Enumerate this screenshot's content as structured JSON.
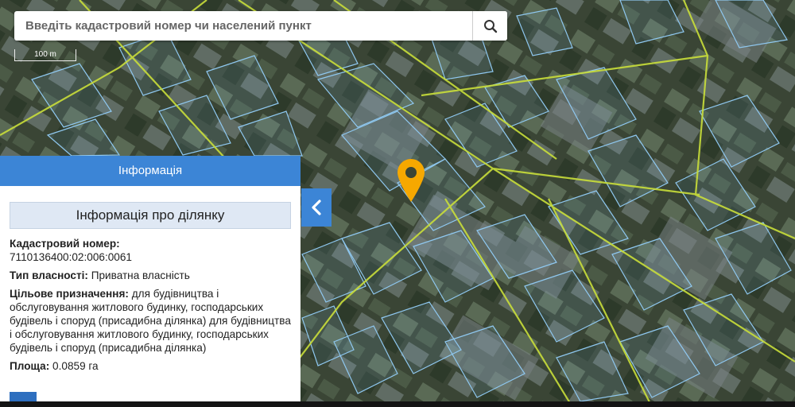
{
  "search": {
    "placeholder": "Введіть кадастровий номер чи населений пункт",
    "icon": "search-icon"
  },
  "scale": {
    "label": "100 m"
  },
  "marker": {
    "icon": "map-pin-icon",
    "color": "#f6a800"
  },
  "panel": {
    "header": "Інформація",
    "section_title": "Інформація про ділянку",
    "cadastral_label": "Кадастровий номер:",
    "cadastral_value": "7110136400:02:006:0061",
    "ownership_label": "Тип власності:",
    "ownership_value": "Приватна власність",
    "purpose_label": "Цільове призначення:",
    "purpose_value": "для будівництва і обслуговування житлового будинку, господарських будівель і споруд (присадибна ділянка) для будівництва і обслуговування житлового будинку, господарських будівель і споруд (присадибна ділянка)",
    "area_label": "Площа:",
    "area_value": "0.0859 га",
    "collapse_icon": "chevron-left-icon"
  },
  "colors": {
    "accent": "#3c85d6",
    "parcel": "#8fc8f0",
    "road": "#c9de3a",
    "marker": "#f6a800"
  }
}
